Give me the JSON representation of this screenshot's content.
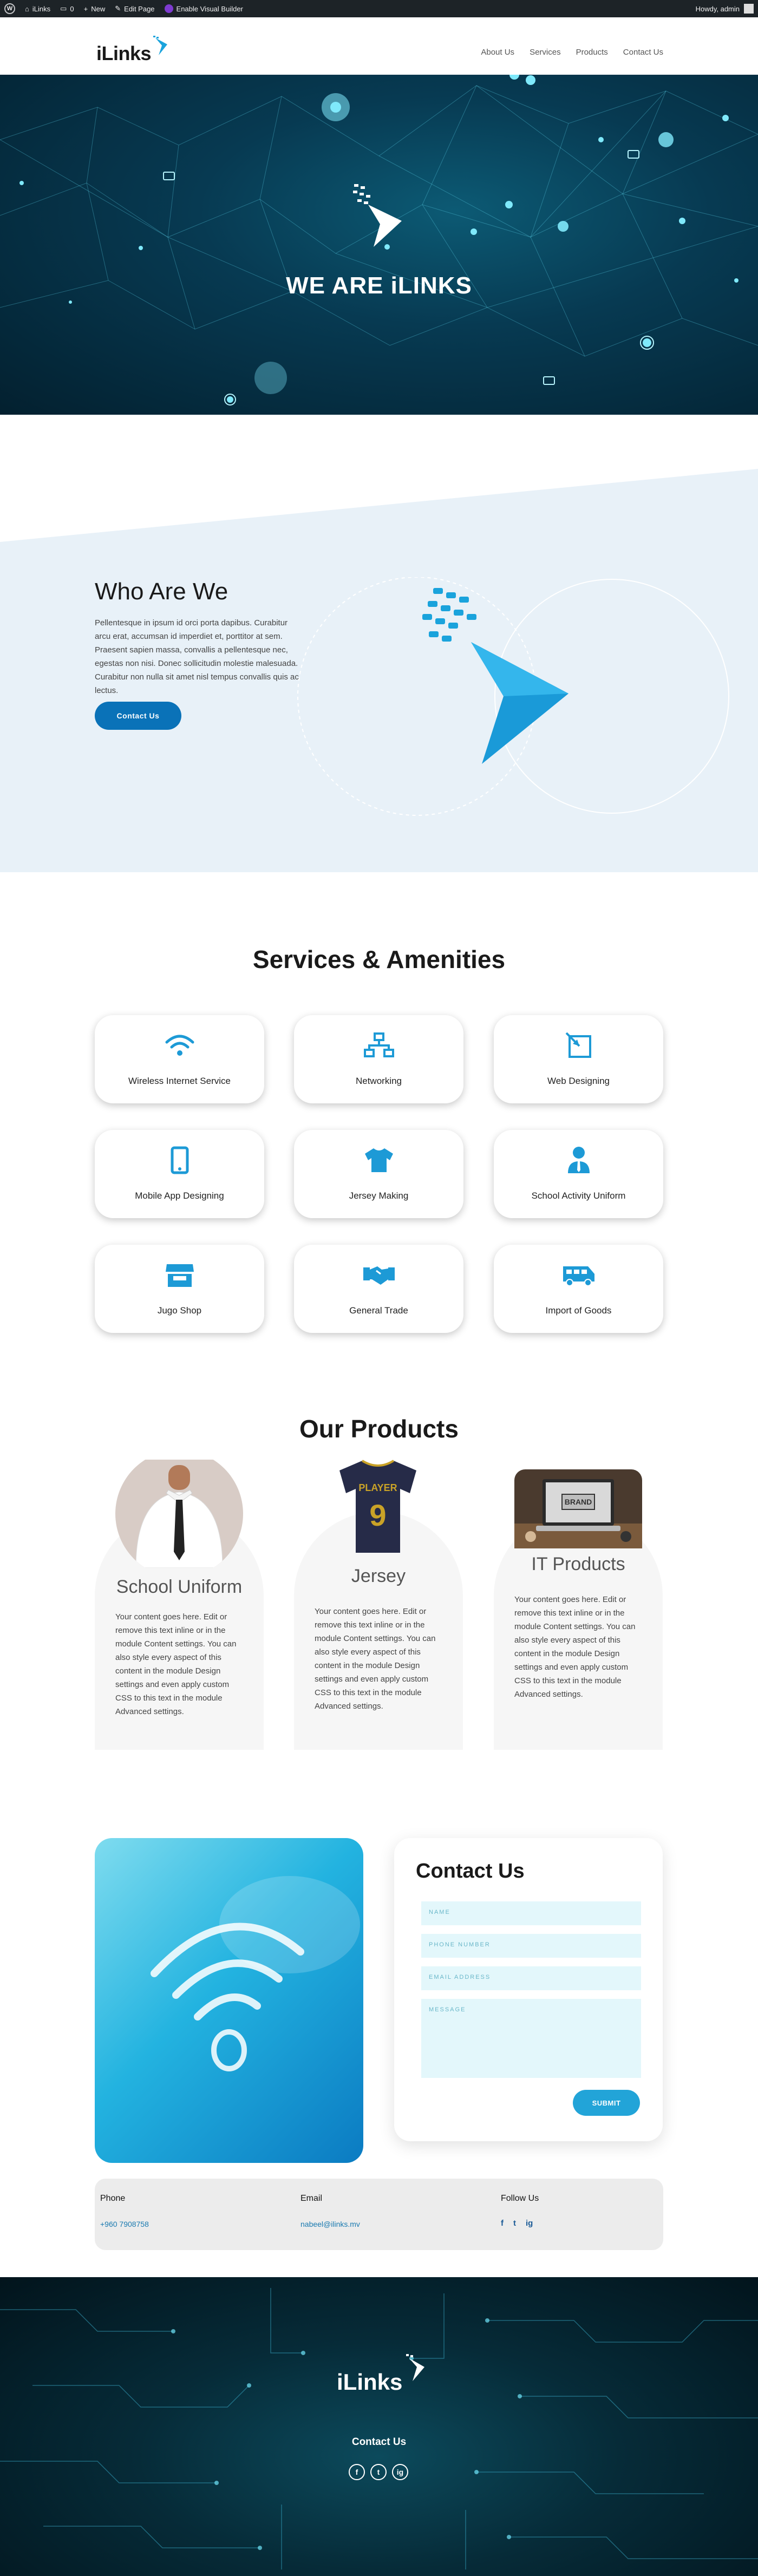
{
  "admin_bar": {
    "site_name": "iLinks",
    "comments_count": "0",
    "new_label": "New",
    "edit_label": "Edit Page",
    "builder_label": "Enable Visual Builder",
    "greeting": "Howdy, admin"
  },
  "header": {
    "logo_text": "iLinks",
    "nav": [
      "About Us",
      "Services",
      "Products",
      "Contact Us"
    ]
  },
  "hero": {
    "title": "WE ARE iLINKS"
  },
  "who": {
    "title": "Who Are We",
    "body": "Pellentesque in ipsum id orci porta dapibus. Curabitur arcu erat, accumsan id imperdiet et, porttitor at sem. Praesent sapien massa, convallis a pellentesque nec, egestas non nisi. Donec sollicitudin molestie malesuada. Curabitur non nulla sit amet nisl tempus convallis quis ac lectus.",
    "button": "Contact Us"
  },
  "services": {
    "title": "Services & Amenities",
    "items": [
      {
        "label": "Wireless Internet Service",
        "icon": "wifi-icon"
      },
      {
        "label": "Networking",
        "icon": "network-icon"
      },
      {
        "label": "Web Designing",
        "icon": "web-design-icon"
      },
      {
        "label": "Mobile App Designing",
        "icon": "mobile-icon"
      },
      {
        "label": "Jersey Making",
        "icon": "tshirt-icon"
      },
      {
        "label": "School Activity Uniform",
        "icon": "uniform-icon"
      },
      {
        "label": "Jugo Shop",
        "icon": "shop-icon"
      },
      {
        "label": "General Trade",
        "icon": "handshake-icon"
      },
      {
        "label": "Import of Goods",
        "icon": "truck-icon"
      }
    ],
    "accent": "#1d9ad6"
  },
  "products": {
    "title": "Our Products",
    "items": [
      {
        "name": "School Uniform",
        "text": "Your content goes here. Edit or remove this text inline or in the module Content settings. You can also style every aspect of this content in the module Design settings and even apply custom CSS to this text in the module Advanced settings."
      },
      {
        "name": "Jersey",
        "text": "Your content goes here. Edit or remove this text inline or in the module Content settings. You can also style every aspect of this content in the module Design settings and even apply custom CSS to this text in the module Advanced settings.",
        "jersey_text": "PLAYER",
        "jersey_number": "9"
      },
      {
        "name": "IT Products",
        "text": "Your content goes here. Edit or remove this text inline or in the module Content settings. You can also style every aspect of this content in the module Design settings and even apply custom CSS to this text in the module Advanced settings.",
        "screen_text": "BRAND"
      }
    ]
  },
  "contact": {
    "title": "Contact Us",
    "name_placeholder": "NAME",
    "phone_placeholder": "PHONE NUMBER",
    "email_placeholder": "EMAIL ADDRESS",
    "message_placeholder": "MESSAGE",
    "submit": "SUBMIT"
  },
  "info": {
    "phone_label": "Phone",
    "phone_value": "+960 7908758",
    "email_label": "Email",
    "email_value": "nabeel@ilinks.mv",
    "follow_label": "Follow Us",
    "social": [
      "f",
      "t",
      "ig"
    ]
  },
  "footer": {
    "logo_text": "iLinks",
    "contact_label": "Contact Us",
    "social": [
      "f",
      "t",
      "ig"
    ]
  },
  "colors": {
    "brand_blue": "#0a72b8",
    "accent_cyan": "#22a4d8",
    "hero_dark": "#03202f"
  }
}
